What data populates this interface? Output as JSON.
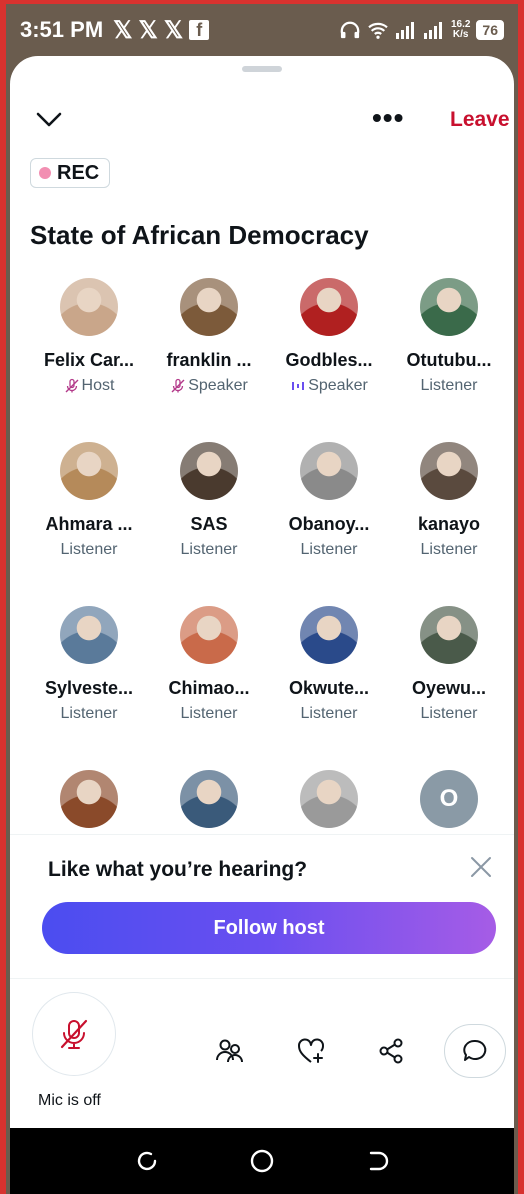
{
  "status_bar": {
    "time": "3:51 PM",
    "notification_icons": [
      "𝕏",
      "𝕏",
      "𝕏"
    ],
    "fb_icon": "f",
    "speed_value": "16.2",
    "speed_unit": "K/s",
    "battery": "76"
  },
  "header": {
    "leave_label": "Leave",
    "more_label": "•••",
    "rec_label": "REC",
    "space_title": "State of African Democracy"
  },
  "participants": [
    {
      "name": "Felix Car...",
      "role": "Host",
      "muted": true,
      "color": "#c9a68a"
    },
    {
      "name": "franklin ...",
      "role": "Speaker",
      "muted": true,
      "color": "#7c5a3a"
    },
    {
      "name": "Godbles...",
      "role": "Speaker",
      "muted": false,
      "color": "#b02020"
    },
    {
      "name": "Otutubu...",
      "role": "Listener",
      "muted": false,
      "color": "#3a6a4a"
    },
    {
      "name": "Ahmara ...",
      "role": "Listener",
      "muted": false,
      "color": "#b58a5a"
    },
    {
      "name": "SAS",
      "role": "Listener",
      "muted": false,
      "color": "#4a3a2e"
    },
    {
      "name": "Obanoy...",
      "role": "Listener",
      "muted": false,
      "color": "#8a8a8a"
    },
    {
      "name": "kanayo",
      "role": "Listener",
      "muted": false,
      "color": "#5a4a3e"
    },
    {
      "name": "Sylveste...",
      "role": "Listener",
      "muted": false,
      "color": "#5a7a9a"
    },
    {
      "name": "Chimao...",
      "role": "Listener",
      "muted": false,
      "color": "#c96a4a"
    },
    {
      "name": "Okwute...",
      "role": "Listener",
      "muted": false,
      "color": "#2a4a8a"
    },
    {
      "name": "Oyewu...",
      "role": "Listener",
      "muted": false,
      "color": "#4a5a4a"
    },
    {
      "name": "",
      "role": "",
      "muted": false,
      "color": "#8a4a2a"
    },
    {
      "name": "",
      "role": "",
      "muted": false,
      "color": "#3a5a7a"
    },
    {
      "name": "",
      "role": "",
      "muted": false,
      "color": "#9a9a9a"
    },
    {
      "name": "",
      "role": "",
      "muted": false,
      "color": "#8a9aa6",
      "initial": "O"
    }
  ],
  "follow_card": {
    "prompt": "Like what you’re hearing?",
    "button_label": "Follow host"
  },
  "controls": {
    "mic_label": "Mic is off"
  },
  "colors": {
    "accent_red": "#c8102e",
    "follow_gradient_start": "#4b4df0",
    "follow_gradient_end": "#a65ce6"
  }
}
